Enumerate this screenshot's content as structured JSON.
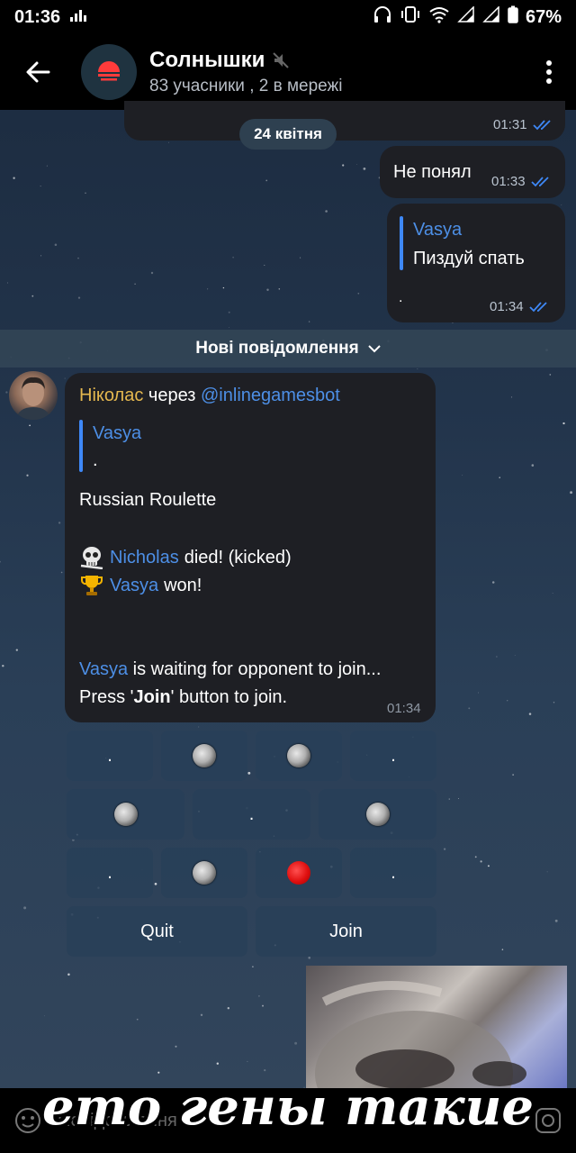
{
  "status_bar": {
    "time": "01:36",
    "battery": "67%"
  },
  "header": {
    "title": "Солнышки",
    "subtitle": "83 учасники , 2 в мережі"
  },
  "date_separator": "24 квітня",
  "messages": [
    {
      "time": "01:31"
    },
    {
      "text": "Не понял",
      "time": "01:33"
    },
    {
      "reply_name": "Vasya",
      "reply_text": "Пиздуй спать",
      "text": ".",
      "time": "01:34"
    }
  ],
  "new_messages_label": "Нові повідомлення",
  "game_message": {
    "sender": "Ніколас",
    "via": "через",
    "bot": "@inlinegamesbot",
    "reply_name": "Vasya",
    "reply_text": ".",
    "title": "Russian Roulette",
    "line1_name": "Nicholas",
    "line1_text": "died! (kicked)",
    "line2_name": "Vasya",
    "line2_text": "won!",
    "wait_name": "Vasya",
    "wait_text": "is waiting for opponent to join...",
    "press_pre": "Press '",
    "press_bold": "Join",
    "press_post": "' button to join.",
    "time": "01:34"
  },
  "keyboard": {
    "row1": [
      ".",
      "grey",
      "grey",
      "."
    ],
    "row2": [
      "grey",
      ".",
      "grey"
    ],
    "row3": [
      ".",
      "grey",
      "red",
      "."
    ],
    "quit_label": "Quit",
    "join_label": "Join"
  },
  "input_placeholder": "Повідомлення",
  "meme_caption": "ето гены такие",
  "colors": {
    "accent_blue": "#4d8fe6",
    "sender_gold": "#e5b84f",
    "bubble": "#1e1f24"
  }
}
